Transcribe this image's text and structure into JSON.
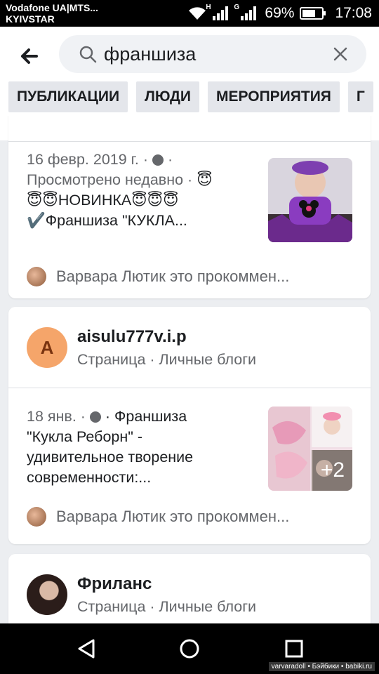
{
  "status_bar": {
    "carrier_line1": "Vodafone UA|MTS...",
    "carrier_line2": "KYIVSTAR",
    "signal1_tag": "H",
    "signal2_tag": "G",
    "battery_percent": "69%",
    "battery_level": 0.69,
    "time": "17:08"
  },
  "search": {
    "query": "франшиза",
    "back_icon": "arrow-left-icon",
    "search_icon": "magnifier-icon",
    "clear_icon": "close-icon"
  },
  "tabs": [
    "ПУБЛИКАЦИИ",
    "ЛЮДИ",
    "МЕРОПРИЯТИЯ",
    "Г"
  ],
  "feed": {
    "post1": {
      "date": "16 февр. 2019 г. ·",
      "line2": "Просмотрено недавно ·",
      "line3": "НОВИНКА",
      "line4": "✔️Франшиза \"КУКЛА...",
      "comment": "Варвара Лютик это прокоммен..."
    },
    "page1": {
      "avatar_letter": "A",
      "name": "aisulu777v.i.p",
      "subtitle": "Страница · Личные блоги"
    },
    "post2": {
      "date": "18 янв. ·",
      "line1_rest": "· Франшиза",
      "line2": "\"Кукла Реборн\"  -",
      "line3": "удивительное творение",
      "line4": "современности:...",
      "thumb_count": "+2",
      "comment": "Варвара Лютик это прокоммен..."
    },
    "page2": {
      "name": "Фриланс",
      "subtitle": "Страница · Личные блоги"
    }
  },
  "watermark": "varvaradoll • Бэйбики • babiki.ru",
  "colors": {
    "background": "#eceef1",
    "card": "#ffffff",
    "text": "#1c1e21",
    "secondary": "#65676b",
    "tab_bg": "#e4e6eb",
    "avatar_orange": "#f5a56a"
  }
}
